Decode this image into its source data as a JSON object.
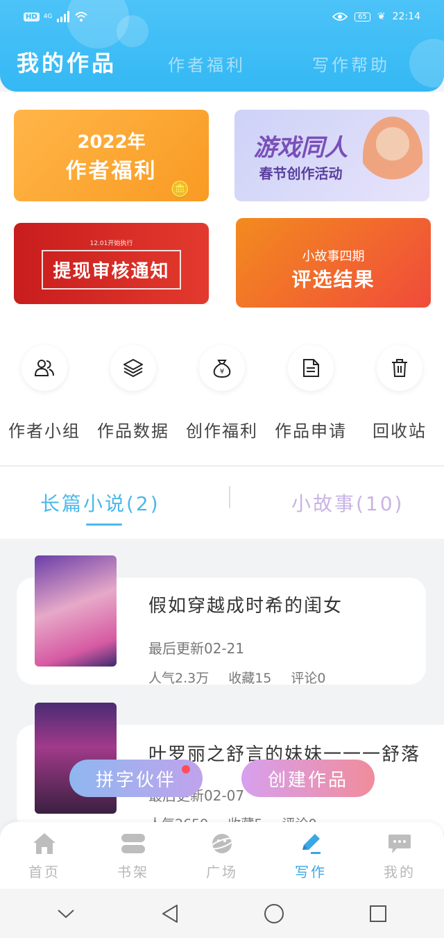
{
  "status_bar": {
    "network_badge": "HD",
    "network_type": "4G",
    "battery": "65",
    "time": "22:14"
  },
  "header": {
    "tabs": [
      {
        "label": "我的作品"
      },
      {
        "label": "作者福利"
      },
      {
        "label": "写作帮助"
      }
    ]
  },
  "banners": {
    "b1": {
      "line1": "2022年",
      "line2": "作者福利"
    },
    "b2": {
      "line1": "游戏同人",
      "line2": "春节创作活动"
    },
    "b3": {
      "small": "12.01开始执行",
      "main": "提现审核通知"
    },
    "b4": {
      "line1": "小故事四期",
      "line2": "评选结果"
    }
  },
  "grid": [
    {
      "label": "作者小组",
      "icon": "users-icon"
    },
    {
      "label": "作品数据",
      "icon": "layers-icon"
    },
    {
      "label": "创作福利",
      "icon": "money-bag-icon"
    },
    {
      "label": "作品申请",
      "icon": "document-icon"
    },
    {
      "label": "回收站",
      "icon": "trash-icon"
    }
  ],
  "segments": {
    "long": "长篇小说(2)",
    "short": "小故事(10)"
  },
  "works": [
    {
      "title": "假如穿越成时希的闺女",
      "updated": "最后更新02-21",
      "popularity": "人气2.3万",
      "favorites": "收藏15",
      "comments": "评论0"
    },
    {
      "title": "叶罗丽之舒言的妹妹一一一舒落",
      "updated": "最后更新02-07",
      "popularity": "人气2659",
      "favorites": "收藏5",
      "comments": "评论0"
    }
  ],
  "actions": {
    "partner": "拼字伙伴",
    "create": "创建作品"
  },
  "bottom_nav": [
    {
      "label": "首页",
      "icon": "home-icon"
    },
    {
      "label": "书架",
      "icon": "bookshelf-icon"
    },
    {
      "label": "广场",
      "icon": "planet-icon"
    },
    {
      "label": "写作",
      "icon": "pen-icon"
    },
    {
      "label": "我的",
      "icon": "chat-icon"
    }
  ],
  "colors": {
    "header": "#34b8f4",
    "accent": "#3aa7e6",
    "nav_inactive": "#b8b8b8"
  }
}
